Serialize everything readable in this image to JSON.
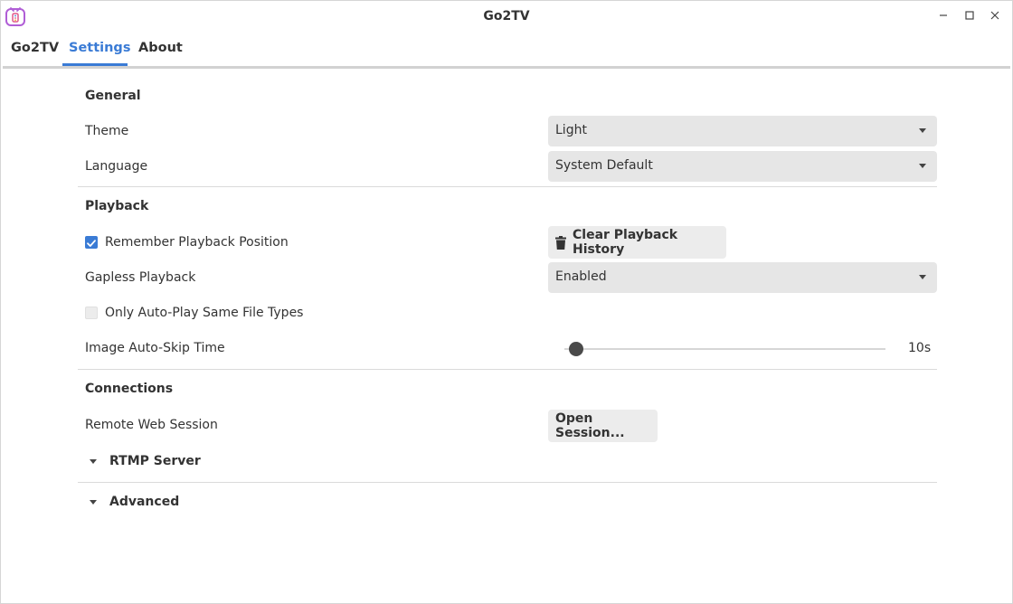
{
  "window": {
    "title": "Go2TV",
    "icon": "go2tv-app-icon",
    "controls": [
      "minimize",
      "maximize",
      "close"
    ]
  },
  "tabs": [
    {
      "label": "Go2TV",
      "active": false
    },
    {
      "label": "Settings",
      "active": true
    },
    {
      "label": "About",
      "active": false
    }
  ],
  "general": {
    "title": "General",
    "theme_label": "Theme",
    "theme_value": "Light",
    "language_label": "Language",
    "language_value": "System Default"
  },
  "playback": {
    "title": "Playback",
    "remember_label": "Remember Playback Position",
    "remember_checked": true,
    "clear_history_label": "Clear Playback History",
    "clear_history_icon": "trash-icon",
    "gapless_label": "Gapless Playback",
    "gapless_value": "Enabled",
    "autoplay_label": "Only Auto-Play Same File Types",
    "autoplay_checked": false,
    "autoskip_label": "Image Auto-Skip Time",
    "autoskip_value": "10s",
    "autoskip_level": 0.02
  },
  "connections": {
    "title": "Connections",
    "remote_label": "Remote Web Session",
    "open_session_label": "Open Session...",
    "rtmp_label": "RTMP Server",
    "advanced_label": "Advanced"
  },
  "colors": {
    "accent": "#3a7bd5",
    "select_bg": "#e6e6e6",
    "button_bg": "#ececec"
  }
}
